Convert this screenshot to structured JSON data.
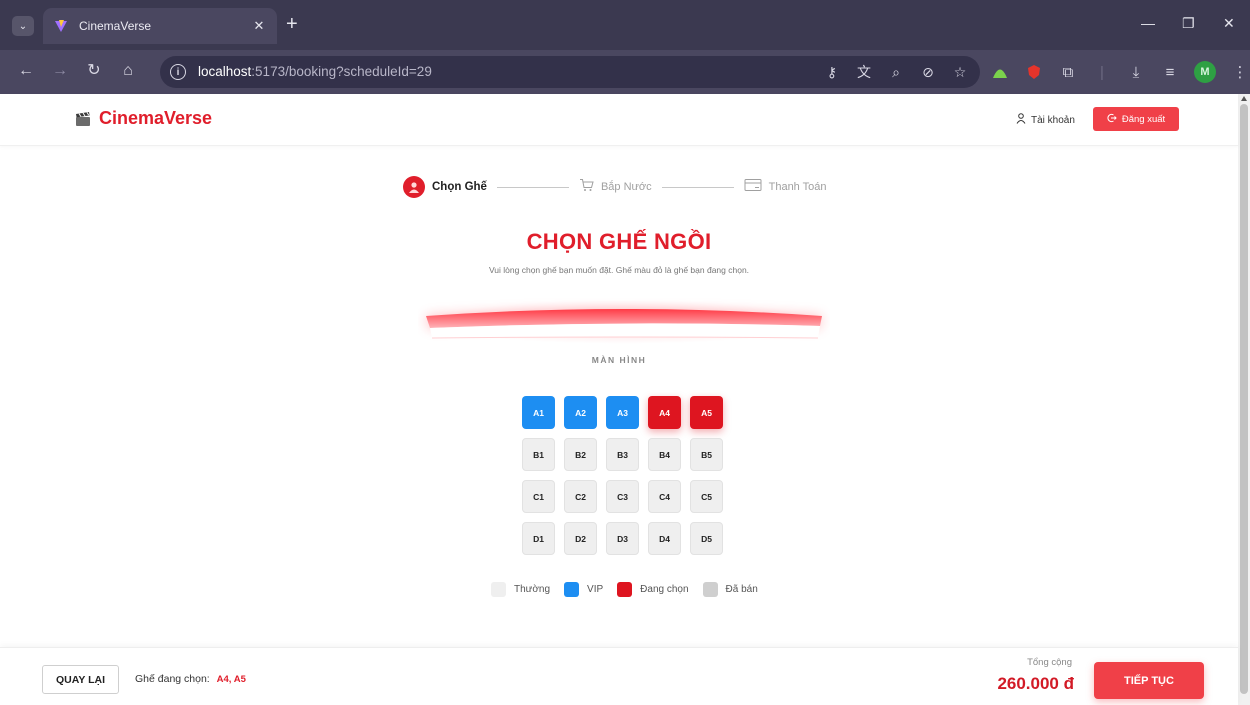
{
  "browser": {
    "tab_title": "CinemaVerse",
    "url_host": "localhost",
    "url_rest": ":5173/booking?scheduleId=29",
    "profile_initial": "M"
  },
  "header": {
    "logo_text": "CinemaVerse",
    "account_label": "Tài khoản",
    "logout_label": "Đăng xuất"
  },
  "steps": [
    {
      "label": "Chọn Ghế",
      "active": true
    },
    {
      "label": "Bắp Nước",
      "active": false
    },
    {
      "label": "Thanh Toán",
      "active": false
    }
  ],
  "main": {
    "title": "CHỌN GHẾ NGỒI",
    "subtitle": "Vui lòng chọn ghế bạn muốn đặt. Ghế màu đỏ là ghế bạn đang chọn.",
    "screen_label": "MÀN HÌNH"
  },
  "seats": [
    {
      "id": "A1",
      "type": "vip"
    },
    {
      "id": "A2",
      "type": "vip"
    },
    {
      "id": "A3",
      "type": "vip"
    },
    {
      "id": "A4",
      "type": "selected"
    },
    {
      "id": "A5",
      "type": "selected"
    },
    {
      "id": "B1",
      "type": "normal"
    },
    {
      "id": "B2",
      "type": "normal"
    },
    {
      "id": "B3",
      "type": "normal"
    },
    {
      "id": "B4",
      "type": "normal"
    },
    {
      "id": "B5",
      "type": "normal"
    },
    {
      "id": "C1",
      "type": "normal"
    },
    {
      "id": "C2",
      "type": "normal"
    },
    {
      "id": "C3",
      "type": "normal"
    },
    {
      "id": "C4",
      "type": "normal"
    },
    {
      "id": "C5",
      "type": "normal"
    },
    {
      "id": "D1",
      "type": "normal"
    },
    {
      "id": "D2",
      "type": "normal"
    },
    {
      "id": "D3",
      "type": "normal"
    },
    {
      "id": "D4",
      "type": "normal"
    },
    {
      "id": "D5",
      "type": "normal"
    }
  ],
  "legend": [
    {
      "label": "Thường",
      "color": "#efefef"
    },
    {
      "label": "VIP",
      "color": "#1d8ef2"
    },
    {
      "label": "Đang chọn",
      "color": "#de1520"
    },
    {
      "label": "Đã bán",
      "color": "#cfcfcf"
    }
  ],
  "footer": {
    "back_label": "QUAY LẠI",
    "selected_label": "Ghế đang chọn:",
    "selected_seats": "A4, A5",
    "total_label": "Tổng cộng",
    "total_amount": "260.000 đ",
    "continue_label": "TIẾP TỤC"
  },
  "colors": {
    "brand": "#e01e2b",
    "vip": "#1d8ef2",
    "selected": "#de1520",
    "button": "#f04048"
  }
}
